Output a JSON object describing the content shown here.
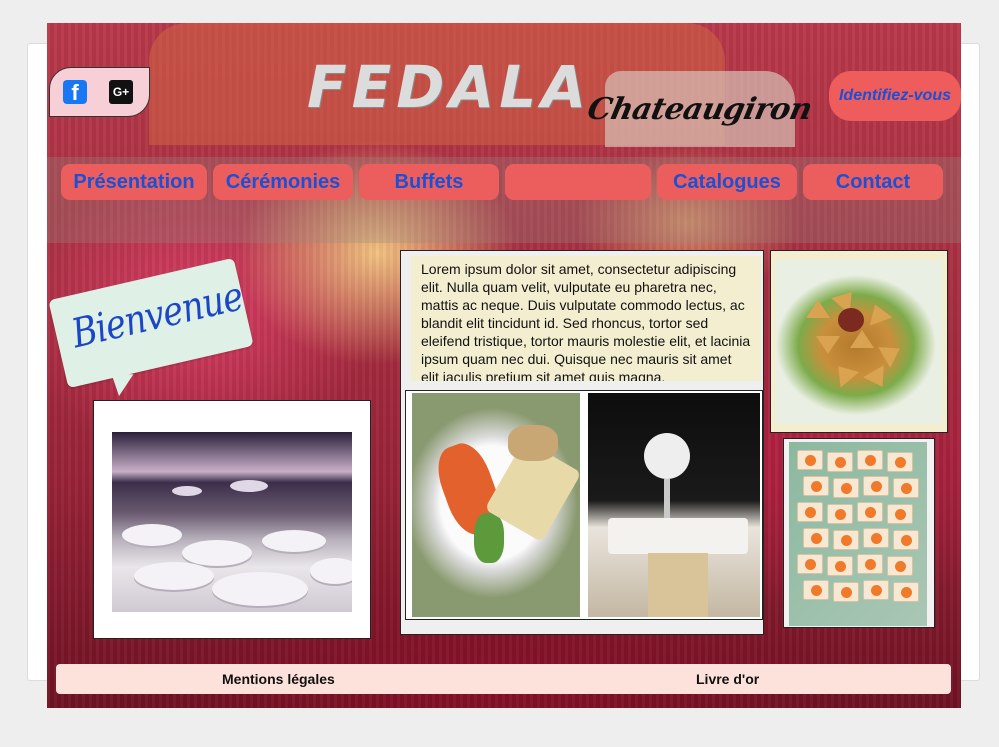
{
  "site": {
    "title": "FEDALA",
    "city": "Chateaugiron",
    "login_label": "Identifiez-vous"
  },
  "social": {
    "facebook_glyph": "f",
    "google_plus_glyph": "G+"
  },
  "nav": {
    "items": [
      {
        "label": "Présentation"
      },
      {
        "label": "Cérémonies"
      },
      {
        "label": "Buffets"
      },
      {
        "label": ""
      },
      {
        "label": "Catalogues"
      },
      {
        "label": "Contact"
      }
    ]
  },
  "welcome": {
    "bubble_text": "Bienvenue"
  },
  "main": {
    "lorem": "Lorem ipsum dolor sit amet, consectetur adipiscing elit. Nulla quam velit, vulputate eu pharetra nec, mattis ac neque. Duis vulputate commodo lectus, ac blandit elit tincidunt id. Sed rhoncus, tortor sed eleifend tristique, tortor mauris molestie elit, et lacinia ipsum quam nec dui. Quisque nec mauris sit amet elit iaculis pretium sit amet quis magna."
  },
  "footer": {
    "legal": "Mentions légales",
    "guestbook": "Livre d'or"
  },
  "colors": {
    "nav_button": "#ec5e5e",
    "nav_text": "#1a50d6",
    "login_button": "#ee5c5c",
    "text_panel": "#f3eed0",
    "footer_bar": "#fde2dc"
  }
}
